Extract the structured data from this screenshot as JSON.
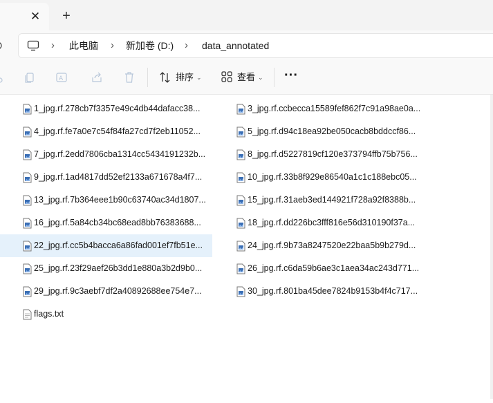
{
  "tabs": {
    "close_glyph": "✕",
    "new_tab_glyph": "+"
  },
  "address": {
    "breadcrumbs": [
      "此电脑",
      "新加卷 (D:)",
      "data_annotated"
    ],
    "separator": "›"
  },
  "toolbar": {
    "sort_label": "排序",
    "view_label": "查看",
    "more_label": "···",
    "dropdown_glyph": "⌄",
    "icons": [
      "cut-icon",
      "copy-icon",
      "rename-icon",
      "share-icon",
      "delete-icon",
      "sort-icon",
      "view-icon"
    ]
  },
  "files": [
    {
      "name": "1_jpg.rf.278cb7f3357e49c4db44dafacc38...",
      "type": "image"
    },
    {
      "name": "3_jpg.rf.ccbecca15589fef862f7c91a98ae0a...",
      "type": "image"
    },
    {
      "name": "4_jpg.rf.fe7a0e7c54f84fa27cd7f2eb11052...",
      "type": "image"
    },
    {
      "name": "5_jpg.rf.d94c18ea92be050cacb8bddccf86...",
      "type": "image"
    },
    {
      "name": "7_jpg.rf.2edd7806cba1314cc5434191232b...",
      "type": "image"
    },
    {
      "name": "8_jpg.rf.d5227819cf120e373794ffb75b756...",
      "type": "image"
    },
    {
      "name": "9_jpg.rf.1ad4817dd52ef2133a671678a4f7...",
      "type": "image"
    },
    {
      "name": "10_jpg.rf.33b8f929e86540a1c1c188ebc05...",
      "type": "image"
    },
    {
      "name": "13_jpg.rf.7b364eee1b90c63740ac34d1807...",
      "type": "image"
    },
    {
      "name": "15_jpg.rf.31aeb3ed144921f728a92f8388b...",
      "type": "image"
    },
    {
      "name": "16_jpg.rf.5a84cb34bc68ead8bb76383688...",
      "type": "image"
    },
    {
      "name": "18_jpg.rf.dd226bc3fff816e56d310190f37a...",
      "type": "image"
    },
    {
      "name": "22_jpg.rf.cc5b4bacca6a86fad001ef7fb51e...",
      "type": "image",
      "selected": true
    },
    {
      "name": "24_jpg.rf.9b73a8247520e22baa5b9b279d...",
      "type": "image"
    },
    {
      "name": "25_jpg.rf.23f29aef26b3dd1e880a3b2d9b0...",
      "type": "image"
    },
    {
      "name": "26_jpg.rf.c6da59b6ae3c1aea34ac243d771...",
      "type": "image"
    },
    {
      "name": "29_jpg.rf.9c3aebf7df2a40892688ee754e7...",
      "type": "image"
    },
    {
      "name": "30_jpg.rf.801ba45dee7824b9153b4f4c717...",
      "type": "image"
    },
    {
      "name": "flags.txt",
      "type": "text"
    }
  ],
  "colors": {
    "selection": "#e5f1fb",
    "file_icon_blue": "#3b6fb5"
  }
}
